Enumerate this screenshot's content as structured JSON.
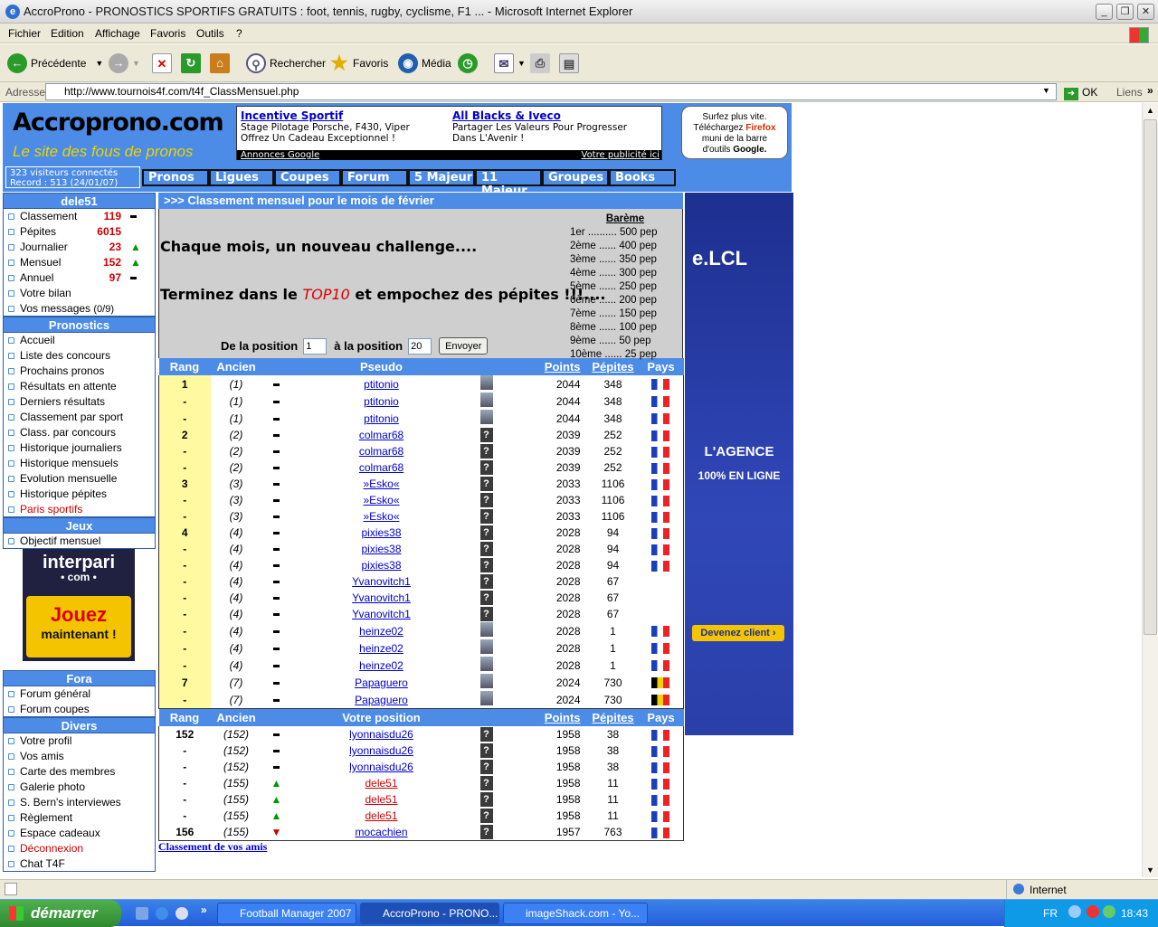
{
  "window": {
    "title": "AccroProno - PRONOSTICS SPORTIFS GRATUITS : foot, tennis, rugby, cyclisme, F1 ... - Microsoft Internet Explorer"
  },
  "menu": [
    "Fichier",
    "Edition",
    "Affichage",
    "Favoris",
    "Outils",
    "?"
  ],
  "toolbar": {
    "back": "Précédente",
    "search": "Rechercher",
    "favorites": "Favoris",
    "media": "Média"
  },
  "address": {
    "label": "Adresse",
    "url": "http://www.tournois4f.com/t4f_ClassMensuel.php",
    "go": "OK",
    "links": "Liens"
  },
  "header": {
    "logo_title": "Accroprono.com",
    "logo_sub": "Le site des fous de pronos",
    "visitors": "323 visiteurs connectés",
    "record": "Record : 513 (24/01/07)"
  },
  "ads": [
    {
      "title": "Incentive Sportif",
      "l1": "Stage Pilotage Porsche, F430, Viper",
      "l2": "Offrez Un Cadeau Exceptionnel !"
    },
    {
      "title": "All Blacks & Iveco",
      "l1": "Partager Les Valeurs Pour Progresser",
      "l2": "Dans L'Avenir !"
    }
  ],
  "ads_footer": {
    "left": "Annonces Google",
    "right": "Votre publicité ici"
  },
  "firefox": {
    "l1": "Surfez plus vite.",
    "l2": "Téléchargez",
    "l2b": "Firefox",
    "l3": "muni de la barre",
    "l4": "d'outils",
    "l4b": "Google."
  },
  "nav": [
    "Pronos",
    "Ligues",
    "Coupes",
    "Forum",
    "5 Majeur",
    "11 Majeur",
    "Groupes",
    "Books"
  ],
  "user": {
    "name": "dele51",
    "stats": [
      {
        "label": "Classement",
        "value": "119",
        "trend": "flat"
      },
      {
        "label": "Pépites",
        "value": "6015",
        "trend": ""
      },
      {
        "label": "Journalier",
        "value": "23",
        "trend": "up"
      },
      {
        "label": "Mensuel",
        "value": "152",
        "trend": "up"
      },
      {
        "label": "Annuel",
        "value": "97",
        "trend": "flat"
      }
    ],
    "bilan": "Votre bilan",
    "messages": "Vos messages",
    "messages_count": "(0/9)"
  },
  "sections": {
    "pronostics": {
      "title": "Pronostics",
      "items": [
        "Accueil",
        "Liste des concours",
        "Prochains pronos",
        "Résultats en attente",
        "Derniers résultats",
        "Classement par sport",
        "Class. par concours",
        "Historique journaliers",
        "Historique mensuels",
        "Evolution mensuelle",
        "Historique pépites",
        "Paris sportifs"
      ]
    },
    "jeux": {
      "title": "Jeux",
      "items": [
        "Objectif mensuel"
      ]
    },
    "fora": {
      "title": "Fora",
      "items": [
        "Forum général",
        "Forum coupes"
      ]
    },
    "divers": {
      "title": "Divers",
      "items": [
        "Votre profil",
        "Vos amis",
        "Carte des membres",
        "Galerie photo",
        "S. Bern's interviewes",
        "Règlement",
        "Espace cadeaux",
        "Déconnexion",
        "Chat T4F"
      ]
    }
  },
  "interpari": {
    "brand1": "interpari",
    "brand2": "• com •",
    "cta1": "Jouez",
    "cta2": "maintenant !"
  },
  "main": {
    "title": ">>> Classement mensuel pour le mois de février",
    "line1": "Chaque mois, un nouveau challenge....",
    "line2a": "Terminez dans le",
    "line2b": "TOP10",
    "line2c": "et empochez des pépites !!!....",
    "form_from": "De la position",
    "form_from_val": "1",
    "form_to": "à la position",
    "form_to_val": "20",
    "submit": "Envoyer"
  },
  "bareme": {
    "title": "Barème",
    "rows": [
      "1er .......... 500 pep",
      "2ème ...... 400 pep",
      "3ème ...... 350 pep",
      "4ème ...... 300 pep",
      "5ème ...... 250 pep",
      "6ème ...... 200 pep",
      "7ème ...... 150 pep",
      "8ème ...... 100 pep",
      "9ème ...... 50 pep",
      "10ème ...... 25 pep"
    ]
  },
  "columns": {
    "rang": "Rang",
    "ancien": "Ancien",
    "pseudo": "Pseudo",
    "votre": "Votre position",
    "points": "Points",
    "pepites": "Pépites",
    "pays": "Pays"
  },
  "rows": [
    {
      "r": "1",
      "a": "(1)",
      "t": "flat",
      "p": "ptitonio",
      "av": "ph",
      "pts": "2044",
      "pep": "348",
      "f": "fr"
    },
    {
      "r": "-",
      "a": "(1)",
      "t": "flat",
      "p": "ptitonio",
      "av": "ph",
      "pts": "2044",
      "pep": "348",
      "f": "fr"
    },
    {
      "r": "-",
      "a": "(1)",
      "t": "flat",
      "p": "ptitonio",
      "av": "ph",
      "pts": "2044",
      "pep": "348",
      "f": "fr"
    },
    {
      "r": "2",
      "a": "(2)",
      "t": "flat",
      "p": "colmar68",
      "av": "q",
      "pts": "2039",
      "pep": "252",
      "f": "fr"
    },
    {
      "r": "-",
      "a": "(2)",
      "t": "flat",
      "p": "colmar68",
      "av": "q",
      "pts": "2039",
      "pep": "252",
      "f": "fr"
    },
    {
      "r": "-",
      "a": "(2)",
      "t": "flat",
      "p": "colmar68",
      "av": "q",
      "pts": "2039",
      "pep": "252",
      "f": "fr"
    },
    {
      "r": "3",
      "a": "(3)",
      "t": "flat",
      "p": "»Esko«",
      "av": "q",
      "pts": "2033",
      "pep": "1106",
      "f": "fr"
    },
    {
      "r": "-",
      "a": "(3)",
      "t": "flat",
      "p": "»Esko«",
      "av": "q",
      "pts": "2033",
      "pep": "1106",
      "f": "fr"
    },
    {
      "r": "-",
      "a": "(3)",
      "t": "flat",
      "p": "»Esko«",
      "av": "q",
      "pts": "2033",
      "pep": "1106",
      "f": "fr"
    },
    {
      "r": "4",
      "a": "(4)",
      "t": "flat",
      "p": "pixies38",
      "av": "q",
      "pts": "2028",
      "pep": "94",
      "f": "fr"
    },
    {
      "r": "-",
      "a": "(4)",
      "t": "flat",
      "p": "pixies38",
      "av": "q",
      "pts": "2028",
      "pep": "94",
      "f": "fr"
    },
    {
      "r": "-",
      "a": "(4)",
      "t": "flat",
      "p": "pixies38",
      "av": "q",
      "pts": "2028",
      "pep": "94",
      "f": "fr"
    },
    {
      "r": "-",
      "a": "(4)",
      "t": "flat",
      "p": "Yvanovitch1",
      "av": "q",
      "pts": "2028",
      "pep": "67",
      "f": ""
    },
    {
      "r": "-",
      "a": "(4)",
      "t": "flat",
      "p": "Yvanovitch1",
      "av": "q",
      "pts": "2028",
      "pep": "67",
      "f": ""
    },
    {
      "r": "-",
      "a": "(4)",
      "t": "flat",
      "p": "Yvanovitch1",
      "av": "q",
      "pts": "2028",
      "pep": "67",
      "f": ""
    },
    {
      "r": "-",
      "a": "(4)",
      "t": "flat",
      "p": "heinze02",
      "av": "ph",
      "pts": "2028",
      "pep": "1",
      "f": "fr"
    },
    {
      "r": "-",
      "a": "(4)",
      "t": "flat",
      "p": "heinze02",
      "av": "ph",
      "pts": "2028",
      "pep": "1",
      "f": "fr"
    },
    {
      "r": "-",
      "a": "(4)",
      "t": "flat",
      "p": "heinze02",
      "av": "ph",
      "pts": "2028",
      "pep": "1",
      "f": "fr"
    },
    {
      "r": "7",
      "a": "(7)",
      "t": "flat",
      "p": "Papaguero",
      "av": "ph",
      "pts": "2024",
      "pep": "730",
      "f": "be"
    },
    {
      "r": "-",
      "a": "(7)",
      "t": "flat",
      "p": "Papaguero",
      "av": "ph",
      "pts": "2024",
      "pep": "730",
      "f": "be"
    }
  ],
  "my_rows": [
    {
      "r": "152",
      "a": "(152)",
      "t": "flat",
      "p": "lyonnaisdu26",
      "pts": "1958",
      "pep": "38",
      "f": "fr",
      "me": false
    },
    {
      "r": "-",
      "a": "(152)",
      "t": "flat",
      "p": "lyonnaisdu26",
      "pts": "1958",
      "pep": "38",
      "f": "fr",
      "me": false
    },
    {
      "r": "-",
      "a": "(152)",
      "t": "flat",
      "p": "lyonnaisdu26",
      "pts": "1958",
      "pep": "38",
      "f": "fr",
      "me": false
    },
    {
      "r": "-",
      "a": "(155)",
      "t": "up",
      "p": "dele51",
      "pts": "1958",
      "pep": "11",
      "f": "fr",
      "me": true
    },
    {
      "r": "-",
      "a": "(155)",
      "t": "up",
      "p": "dele51",
      "pts": "1958",
      "pep": "11",
      "f": "fr",
      "me": true
    },
    {
      "r": "-",
      "a": "(155)",
      "t": "up",
      "p": "dele51",
      "pts": "1958",
      "pep": "11",
      "f": "fr",
      "me": true
    },
    {
      "r": "156",
      "a": "(155)",
      "t": "down",
      "p": "mocachien",
      "pts": "1957",
      "pep": "763",
      "f": "fr",
      "me": false
    }
  ],
  "friends_link": "Classement de vos amis",
  "lcl": {
    "logo": "e.LCL",
    "l1": "L'AGENCE",
    "l2": "100% EN LIGNE",
    "cta": "Devenez client"
  },
  "status": {
    "zone": "Internet"
  },
  "taskbar": {
    "start": "démarrer",
    "tasks": [
      "Football Manager 2007",
      "AccroProno - PRONO...",
      "imageShack.com - Yo..."
    ],
    "lang": "FR",
    "clock": "18:43"
  }
}
